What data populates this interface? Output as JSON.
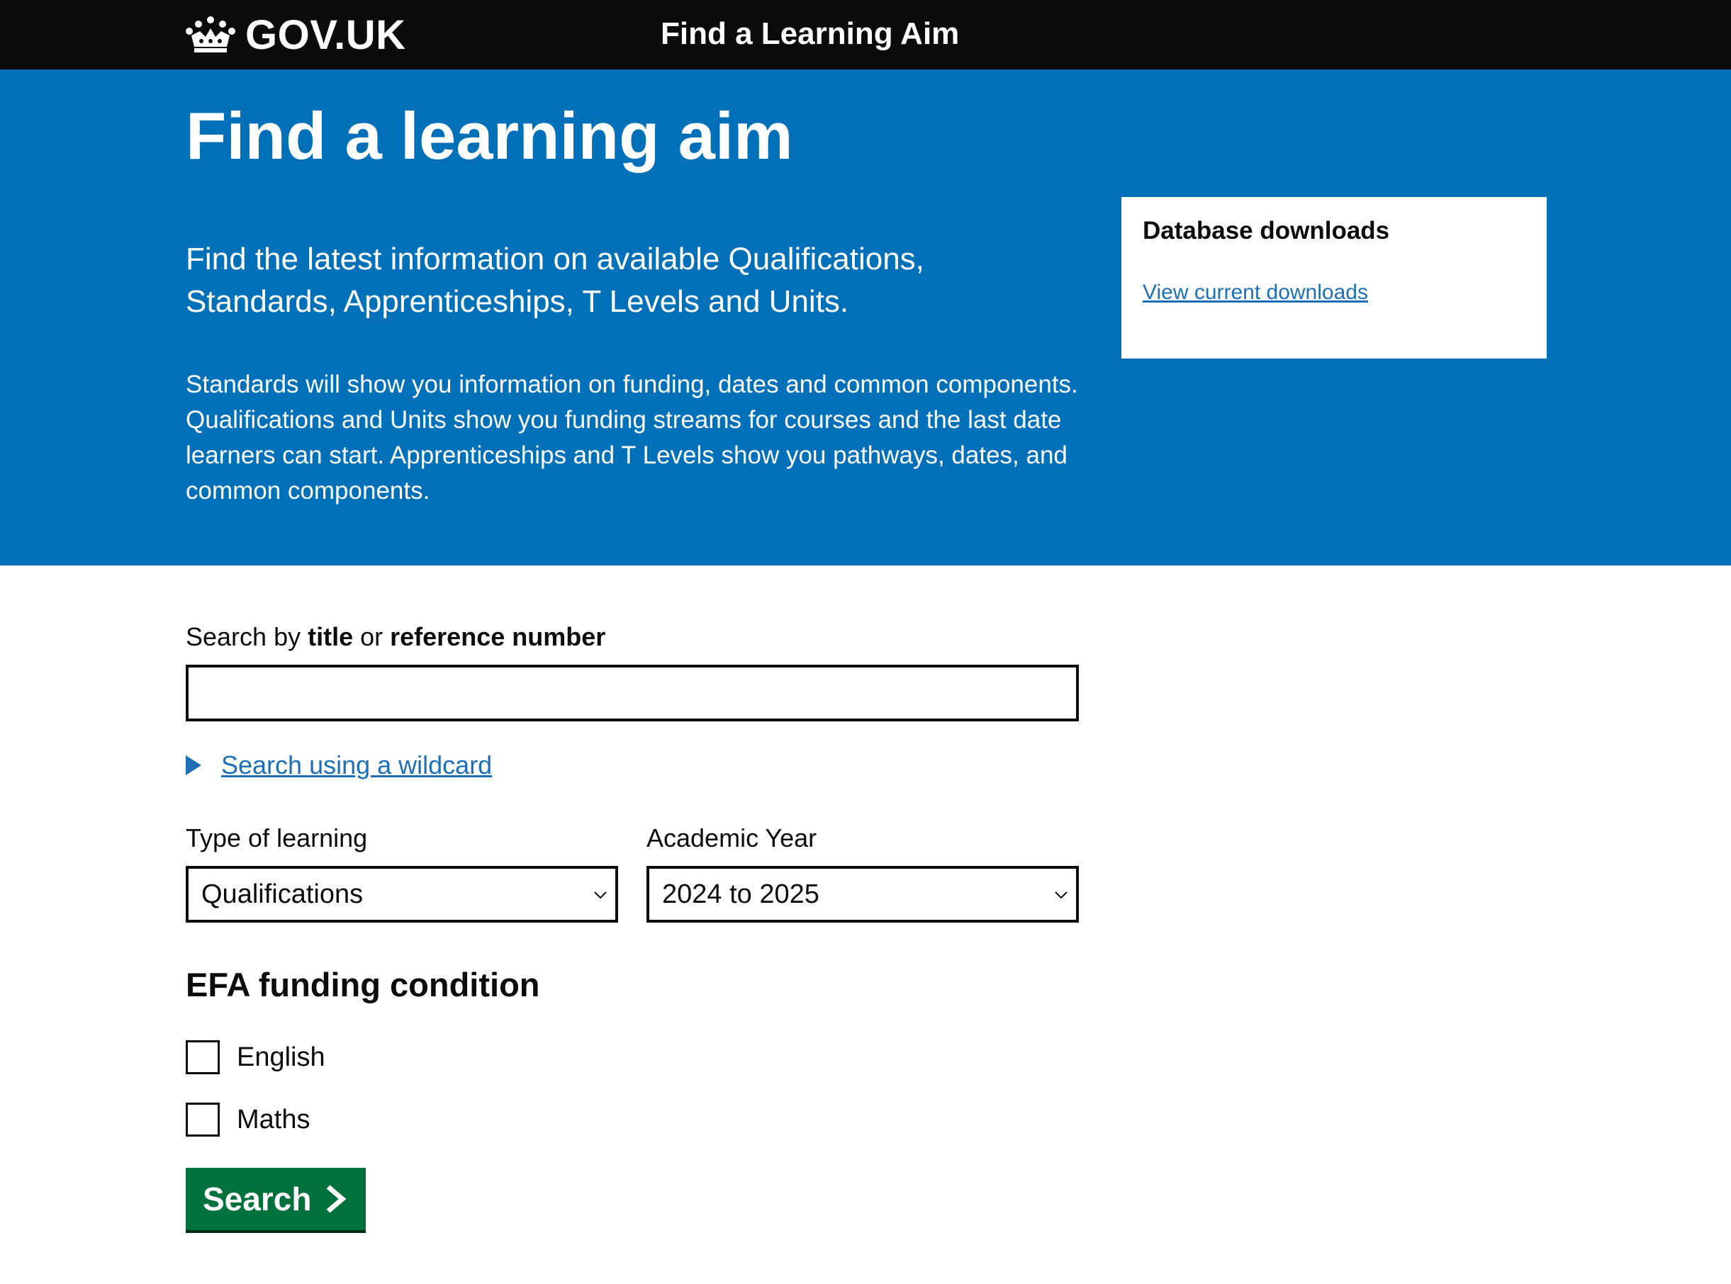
{
  "header": {
    "logo_text": "GOV.UK",
    "service_name": "Find a Learning Aim"
  },
  "hero": {
    "title": "Find a learning aim",
    "lead": "Find the latest information on available Qualifications, Standards, Apprenticeships, T Levels and Units.",
    "body": "Standards will show you information on funding, dates and common components. Qualifications and Units show you funding streams for courses and the last date learners can start. Apprenticeships and T Levels show you pathways, dates, and common components."
  },
  "downloads": {
    "heading": "Database downloads",
    "link": "View current downloads"
  },
  "search": {
    "label_prefix": "Search by ",
    "label_title": "title",
    "label_or": " or ",
    "label_reference": "reference number",
    "value": "",
    "wildcard_link": "Search using a wildcard"
  },
  "filters": {
    "type_label": "Type of learning",
    "type_selected": "Qualifications",
    "year_label": "Academic Year",
    "year_selected": "2024 to 2025"
  },
  "efa": {
    "heading": "EFA funding condition",
    "options": [
      {
        "label": "English",
        "checked": false
      },
      {
        "label": "Maths",
        "checked": false
      }
    ]
  },
  "actions": {
    "search_button": "Search"
  },
  "colors": {
    "header_bg": "#0b0c0c",
    "hero_bg": "#0070b8",
    "link": "#1d70b8",
    "button_bg": "#00703c"
  }
}
